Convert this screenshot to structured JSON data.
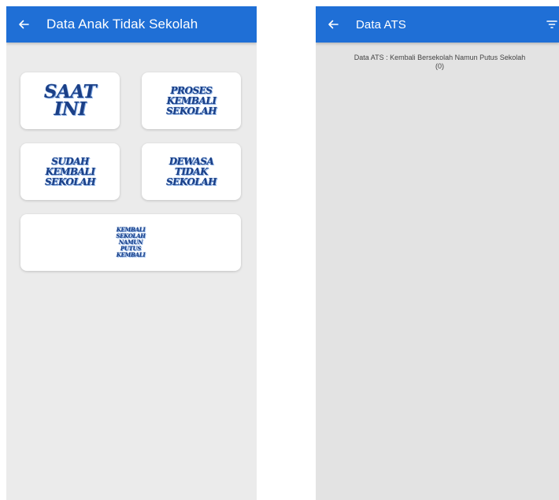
{
  "left_screen": {
    "title": "Data Anak Tidak Sekolah",
    "back_icon": "arrow-left-icon",
    "menu": [
      {
        "label": "SAAT INI"
      },
      {
        "label": "PROSES KEMBALI SEKOLAH"
      },
      {
        "label": "SUDAH KEMBALI SEKOLAH"
      },
      {
        "label": "DEWASA TIDAK SEKOLAH"
      },
      {
        "label": "KEMBALI SEKOLAH NAMUN PUTUS KEMBALI"
      }
    ]
  },
  "right_screen": {
    "title": "Data ATS",
    "back_icon": "arrow-left-icon",
    "filter_icon": "filter-icon",
    "summary_line1": "Data ATS : Kembali Bersekolah Namun Putus Sekolah",
    "summary_line2": "(0)"
  },
  "colors": {
    "appbar": "#1f6fd6",
    "background": "#ebebeb",
    "card": "#ffffff",
    "label": "#1b3f86"
  }
}
